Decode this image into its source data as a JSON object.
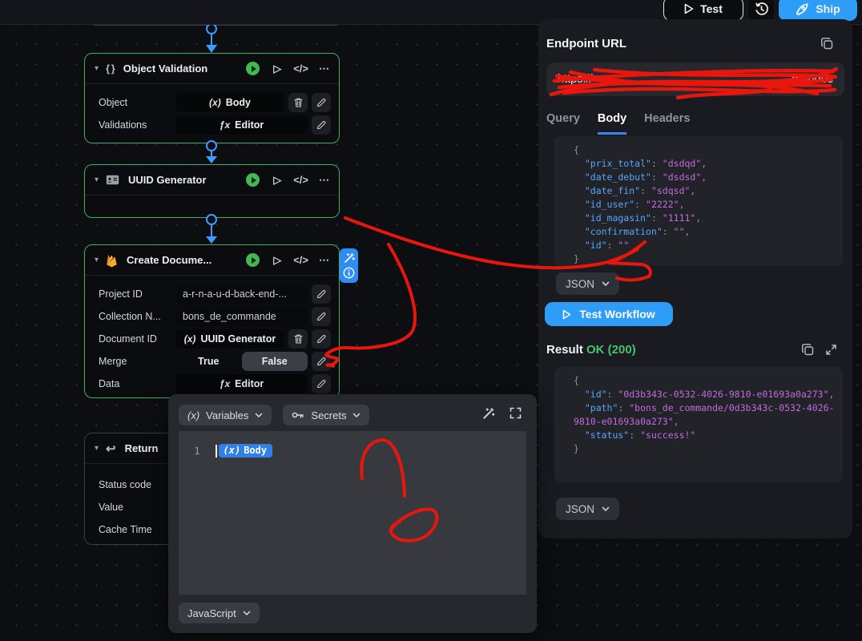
{
  "icons": {
    "chevron_down": "▾",
    "braces": "{ }",
    "dots": "⋯",
    "play_outline": "▷",
    "code": "</>",
    "var": "(x)",
    "fx": "ƒx",
    "return_arrow": "↩"
  },
  "topbar": {
    "test_label": "Test",
    "ship_label": "Ship"
  },
  "nodes": {
    "object_validation": {
      "title": "Object Validation",
      "fields": [
        {
          "label": "Object",
          "chip": "Body"
        },
        {
          "label": "Validations",
          "chip": "Editor"
        }
      ]
    },
    "uuid_generator": {
      "title": "UUID Generator"
    },
    "create_document": {
      "title": "Create Docume...",
      "project_label": "Project ID",
      "project_value": "a-r-n-a-u-d-back-end-...",
      "collection_label": "Collection N...",
      "collection_value": "bons_de_commande",
      "document_label": "Document ID",
      "document_chip": "UUID Generator",
      "merge_label": "Merge",
      "merge_true": "True",
      "merge_false": "False",
      "data_label": "Data",
      "data_chip": "Editor"
    },
    "return_node": {
      "title": "Return",
      "fields": [
        "Status code",
        "Value",
        "Cache Time"
      ]
    }
  },
  "editor": {
    "variables_label": "Variables",
    "secrets_label": "Secrets",
    "line_number": "1",
    "body_chip": "Body",
    "language": "JavaScript"
  },
  "panel": {
    "endpoint_label": "Endpoint URL",
    "url_start": "https://",
    "url_end": "mandes",
    "tabs": [
      "Query",
      "Body",
      "Headers"
    ],
    "active_tab": "Body",
    "json_label": "JSON",
    "test_workflow_label": "Test Workflow",
    "result_label": "Result",
    "result_status": "OK (200)",
    "body_code": [
      [
        {
          "c": "p",
          "t": "{"
        }
      ],
      [
        {
          "c": "k",
          "t": "  \"prix_total\""
        },
        {
          "c": "p",
          "t": ": "
        },
        {
          "c": "s",
          "t": "\"dsdqd\","
        }
      ],
      [
        {
          "c": "k",
          "t": "  \"date_debut\""
        },
        {
          "c": "p",
          "t": ": "
        },
        {
          "c": "s",
          "t": "\"dsdsd\","
        }
      ],
      [
        {
          "c": "k",
          "t": "  \"date_fin\""
        },
        {
          "c": "p",
          "t": ": "
        },
        {
          "c": "s",
          "t": "\"sdqsd\","
        }
      ],
      [
        {
          "c": "k",
          "t": "  \"id_user\""
        },
        {
          "c": "p",
          "t": ": "
        },
        {
          "c": "s",
          "t": "\"2222\","
        }
      ],
      [
        {
          "c": "k",
          "t": "  \"id_magasin\""
        },
        {
          "c": "p",
          "t": ": "
        },
        {
          "c": "s",
          "t": "\"1111\","
        }
      ],
      [
        {
          "c": "k",
          "t": "  \"confirmation\""
        },
        {
          "c": "p",
          "t": ": "
        },
        {
          "c": "s",
          "t": "\"\","
        }
      ],
      [
        {
          "c": "k",
          "t": "  \"id\""
        },
        {
          "c": "p",
          "t": ": "
        },
        {
          "c": "s",
          "t": "\"\""
        }
      ],
      [
        {
          "c": "p",
          "t": "}"
        }
      ]
    ],
    "result_code": [
      [
        {
          "c": "p",
          "t": "{"
        }
      ],
      [
        {
          "c": "k",
          "t": "  \"id\""
        },
        {
          "c": "p",
          "t": ": "
        },
        {
          "c": "s",
          "t": "\"0d3b343c-0532-4026-9810-e01693a0a273\","
        }
      ],
      [
        {
          "c": "k",
          "t": "  \"path\""
        },
        {
          "c": "p",
          "t": ": "
        },
        {
          "c": "s",
          "t": "\"bons_de_commande/0d3b343c-0532-4026-"
        }
      ],
      [
        {
          "c": "s",
          "t": "9810-e01693a0a273\","
        }
      ],
      [
        {
          "c": "k",
          "t": "  \"status\""
        },
        {
          "c": "p",
          "t": ": "
        },
        {
          "c": "s",
          "t": "\"success!\""
        }
      ],
      [
        {
          "c": "p",
          "t": "}"
        }
      ]
    ]
  },
  "colors": {
    "accent_blue": "#2e9df7",
    "node_green": "#3fae62",
    "success_green": "#46c46f",
    "annotation_red": "#e8160c",
    "json_key": "#58a6ff",
    "json_string": "#c46bdd"
  }
}
